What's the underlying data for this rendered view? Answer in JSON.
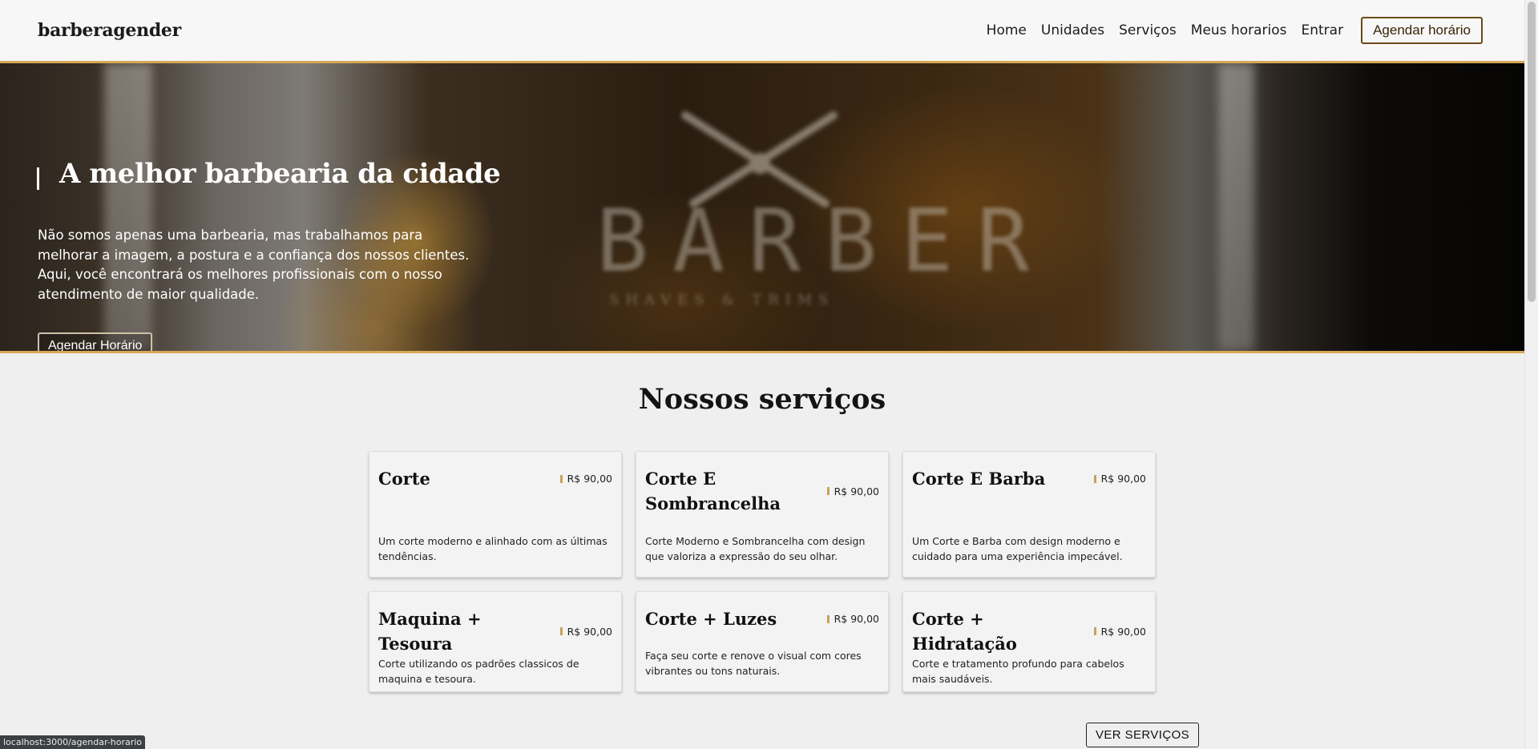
{
  "header": {
    "brand": "barberagender",
    "nav": [
      "Home",
      "Unidades",
      "Serviços",
      "Meus horarios",
      "Entrar"
    ],
    "cta": "Agendar horário"
  },
  "hero": {
    "title": "A melhor barbearia da cidade",
    "text": "Não somos apenas uma barbearia, mas trabalhamos para melhorar a imagem, a postura e a confiança dos nossos clientes. Aqui, você encontrará os melhores profissionais com o nosso atendimento de maior qualidade.",
    "button": "Agendar Horário",
    "background_logo": "BARBER",
    "background_logo_sub": "SHAVES & TRIMS"
  },
  "services": {
    "title": "Nossos serviços",
    "items": [
      {
        "name": "Corte",
        "price": "R$ 90,00",
        "description": "Um corte moderno e alinhado com as últimas tendências."
      },
      {
        "name": "Corte E Sombrancelha",
        "price": "R$ 90,00",
        "description": "Corte Moderno e Sombrancelha com design que valoriza a expressão do seu olhar."
      },
      {
        "name": "Corte E Barba",
        "price": "R$ 90,00",
        "description": "Um Corte e Barba com design moderno e cuidado para uma experiência impecável."
      },
      {
        "name": "Maquina + Tesoura",
        "price": "R$ 90,00",
        "description": "Corte utilizando os padrões classicos de maquina e tesoura."
      },
      {
        "name": "Corte + Luzes",
        "price": "R$ 90,00",
        "description": "Faça seu corte e renove o visual com cores vibrantes ou tons naturais."
      },
      {
        "name": "Corte + Hidratação",
        "price": "R$ 90,00",
        "description": "Corte e tratamento profundo para cabelos mais saudáveis."
      }
    ],
    "more_button": "VER SERVIÇOS"
  },
  "status_bar": {
    "url": "localhost:3000/agendar-horario"
  },
  "colors": {
    "accent": "#d6a856",
    "price_marker": "#c9a15a",
    "background": "#efefef"
  }
}
